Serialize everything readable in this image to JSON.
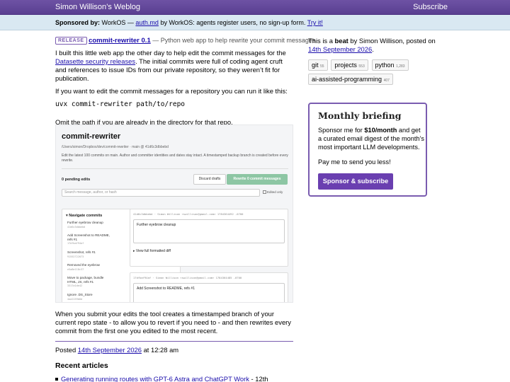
{
  "header": {
    "site_title": "Simon Willison’s Weblog",
    "subscribe_label": "Subscribe"
  },
  "sponsor": {
    "label": "Sponsored by:",
    "sponsor_name": "WorkOS —",
    "link_text": "auth.md",
    "middle_text": "by WorkOS: agents register users, no sign-up form.",
    "cta": "Try it!"
  },
  "post": {
    "badge": "RELEASE",
    "project": "commit-rewriter 0.1",
    "project_desc": "— Python web app to help rewrite your commit messages",
    "para1_a": "I built this little web app the other day to help edit the commit messages for the",
    "para1_link": "Datasette security releases",
    "para1_b": ". The initial commits were full of coding agent cruft and references to issue IDs from our private repository, so they weren’t fit for publication.",
    "para2": "If you want to edit the commit messages for a repository you can run it like this:",
    "code": "uvx commit-rewriter path/to/repo",
    "para3": "Omit the path if you are already in the directory for that repo.",
    "para4": "When you submit your edits the tool creates a timestamped branch of your current repo state - to allow you to revert if you need to - and then rewrites every commit from the first one you edited to the most recent.",
    "posted_label": "Posted",
    "posted_date": "14th September 2026",
    "posted_time": "at 12:28 am"
  },
  "screenshot": {
    "title": "commit-rewriter",
    "path": "/Users/simon/Dropbox/dev/commit-rewriter · main @ 41d6c3dbbebd",
    "desc": "Edit the latest 100 commits on main. Author and committer identities and dates stay intact. A timestamped backup branch is created before every rewrite.",
    "pending": "0 pending edits",
    "discard": "Discard drafts",
    "rewrite": "Rewrite 0 commit messages",
    "search_placeholder": "Search message, author, or hash",
    "edited_only": "Edited only",
    "nav_heading": "▾ Navigate commits",
    "nav_items": [
      {
        "label": "Further eyebrow cleanup",
        "hash": "41d6c3dbbebd"
      },
      {
        "label": "Add Screenshot to README, refs #1",
        "hash": "17dfbaf94af"
      },
      {
        "label": "Screenshot, refs #1",
        "hash": "91552722073"
      },
      {
        "label": "Removed the eyebrow",
        "hash": "e5a8e118c37"
      },
      {
        "label": "Move to package, bundle HTML, JS, refs #1",
        "hash": "3317a1de42"
      },
      {
        "label": "Ignore .DS_Store",
        "hash": "4aa2159b0d"
      }
    ],
    "commit1_meta": "41d6c3dbbebd · Simon Willison <swillison@gmail.com> 1784364492 -0700",
    "commit1_msg": "Further eyebrow cleanup",
    "commit1_diff": "▸ View full formatted diff",
    "commit2_meta": "17dfbaf94af · Simon Willison <swillison@gmail.com> 1784364485 -0700",
    "commit2_msg": "Add Screenshot to README, refs #1"
  },
  "recent": {
    "title": "Recent articles",
    "items": [
      {
        "link": "Generating running routes with GPT-6 Astra and ChatGPT Work",
        "date": " - 12th"
      }
    ]
  },
  "sidebar": {
    "intro_a": "This is a",
    "intro_beat": "beat",
    "intro_b": "by Simon Willison, posted on",
    "intro_date": "14th September 2026",
    "intro_end": ".",
    "tags": [
      {
        "name": "git",
        "count": "55"
      },
      {
        "name": "projects",
        "count": "553"
      },
      {
        "name": "python",
        "count": "1,283"
      },
      {
        "name": "ai-assisted-programming",
        "count": "407"
      }
    ]
  },
  "briefing": {
    "title": "Monthly briefing",
    "text_a": "Sponsor me for",
    "text_price": "$10/month",
    "text_b": "and get a curated email digest of the month’s most important LLM developments.",
    "pay": "Pay me to send you less!",
    "button": "Sponsor & subscribe"
  },
  "colors": {
    "header": "#5a3f91",
    "sponsor_bar": "#d9e8f2",
    "accent": "#7a5cb0",
    "button": "#6a3fb0",
    "link": "#1a0dab"
  }
}
